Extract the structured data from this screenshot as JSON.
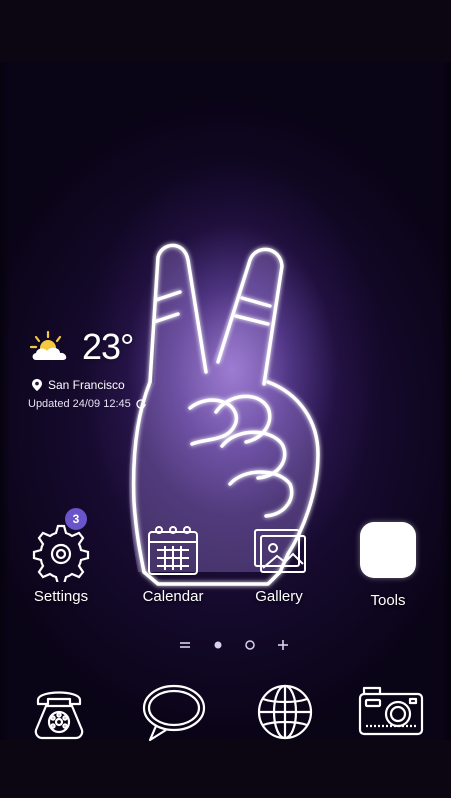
{
  "weather": {
    "icon": "partly-cloudy-icon",
    "temperature": "23°",
    "location": "San Francisco",
    "updated": "Updated 24/09 12:45"
  },
  "apps": [
    {
      "label": "Settings",
      "icon": "gear-icon",
      "badge": "3"
    },
    {
      "label": "Calendar",
      "icon": "calendar-icon"
    },
    {
      "label": "Gallery",
      "icon": "gallery-icon"
    },
    {
      "label": "Tools",
      "icon": "tools-folder-icon"
    }
  ],
  "page_indicator": {
    "pages": 4,
    "current": 2
  },
  "dock": [
    {
      "icon": "phone-icon"
    },
    {
      "icon": "messages-icon"
    },
    {
      "icon": "internet-globe-icon"
    },
    {
      "icon": "camera-icon"
    }
  ],
  "colors": {
    "background": "#160a2e",
    "glow": "#b08ce6",
    "badge": "#6a54c9",
    "neon": "#ffffff"
  }
}
